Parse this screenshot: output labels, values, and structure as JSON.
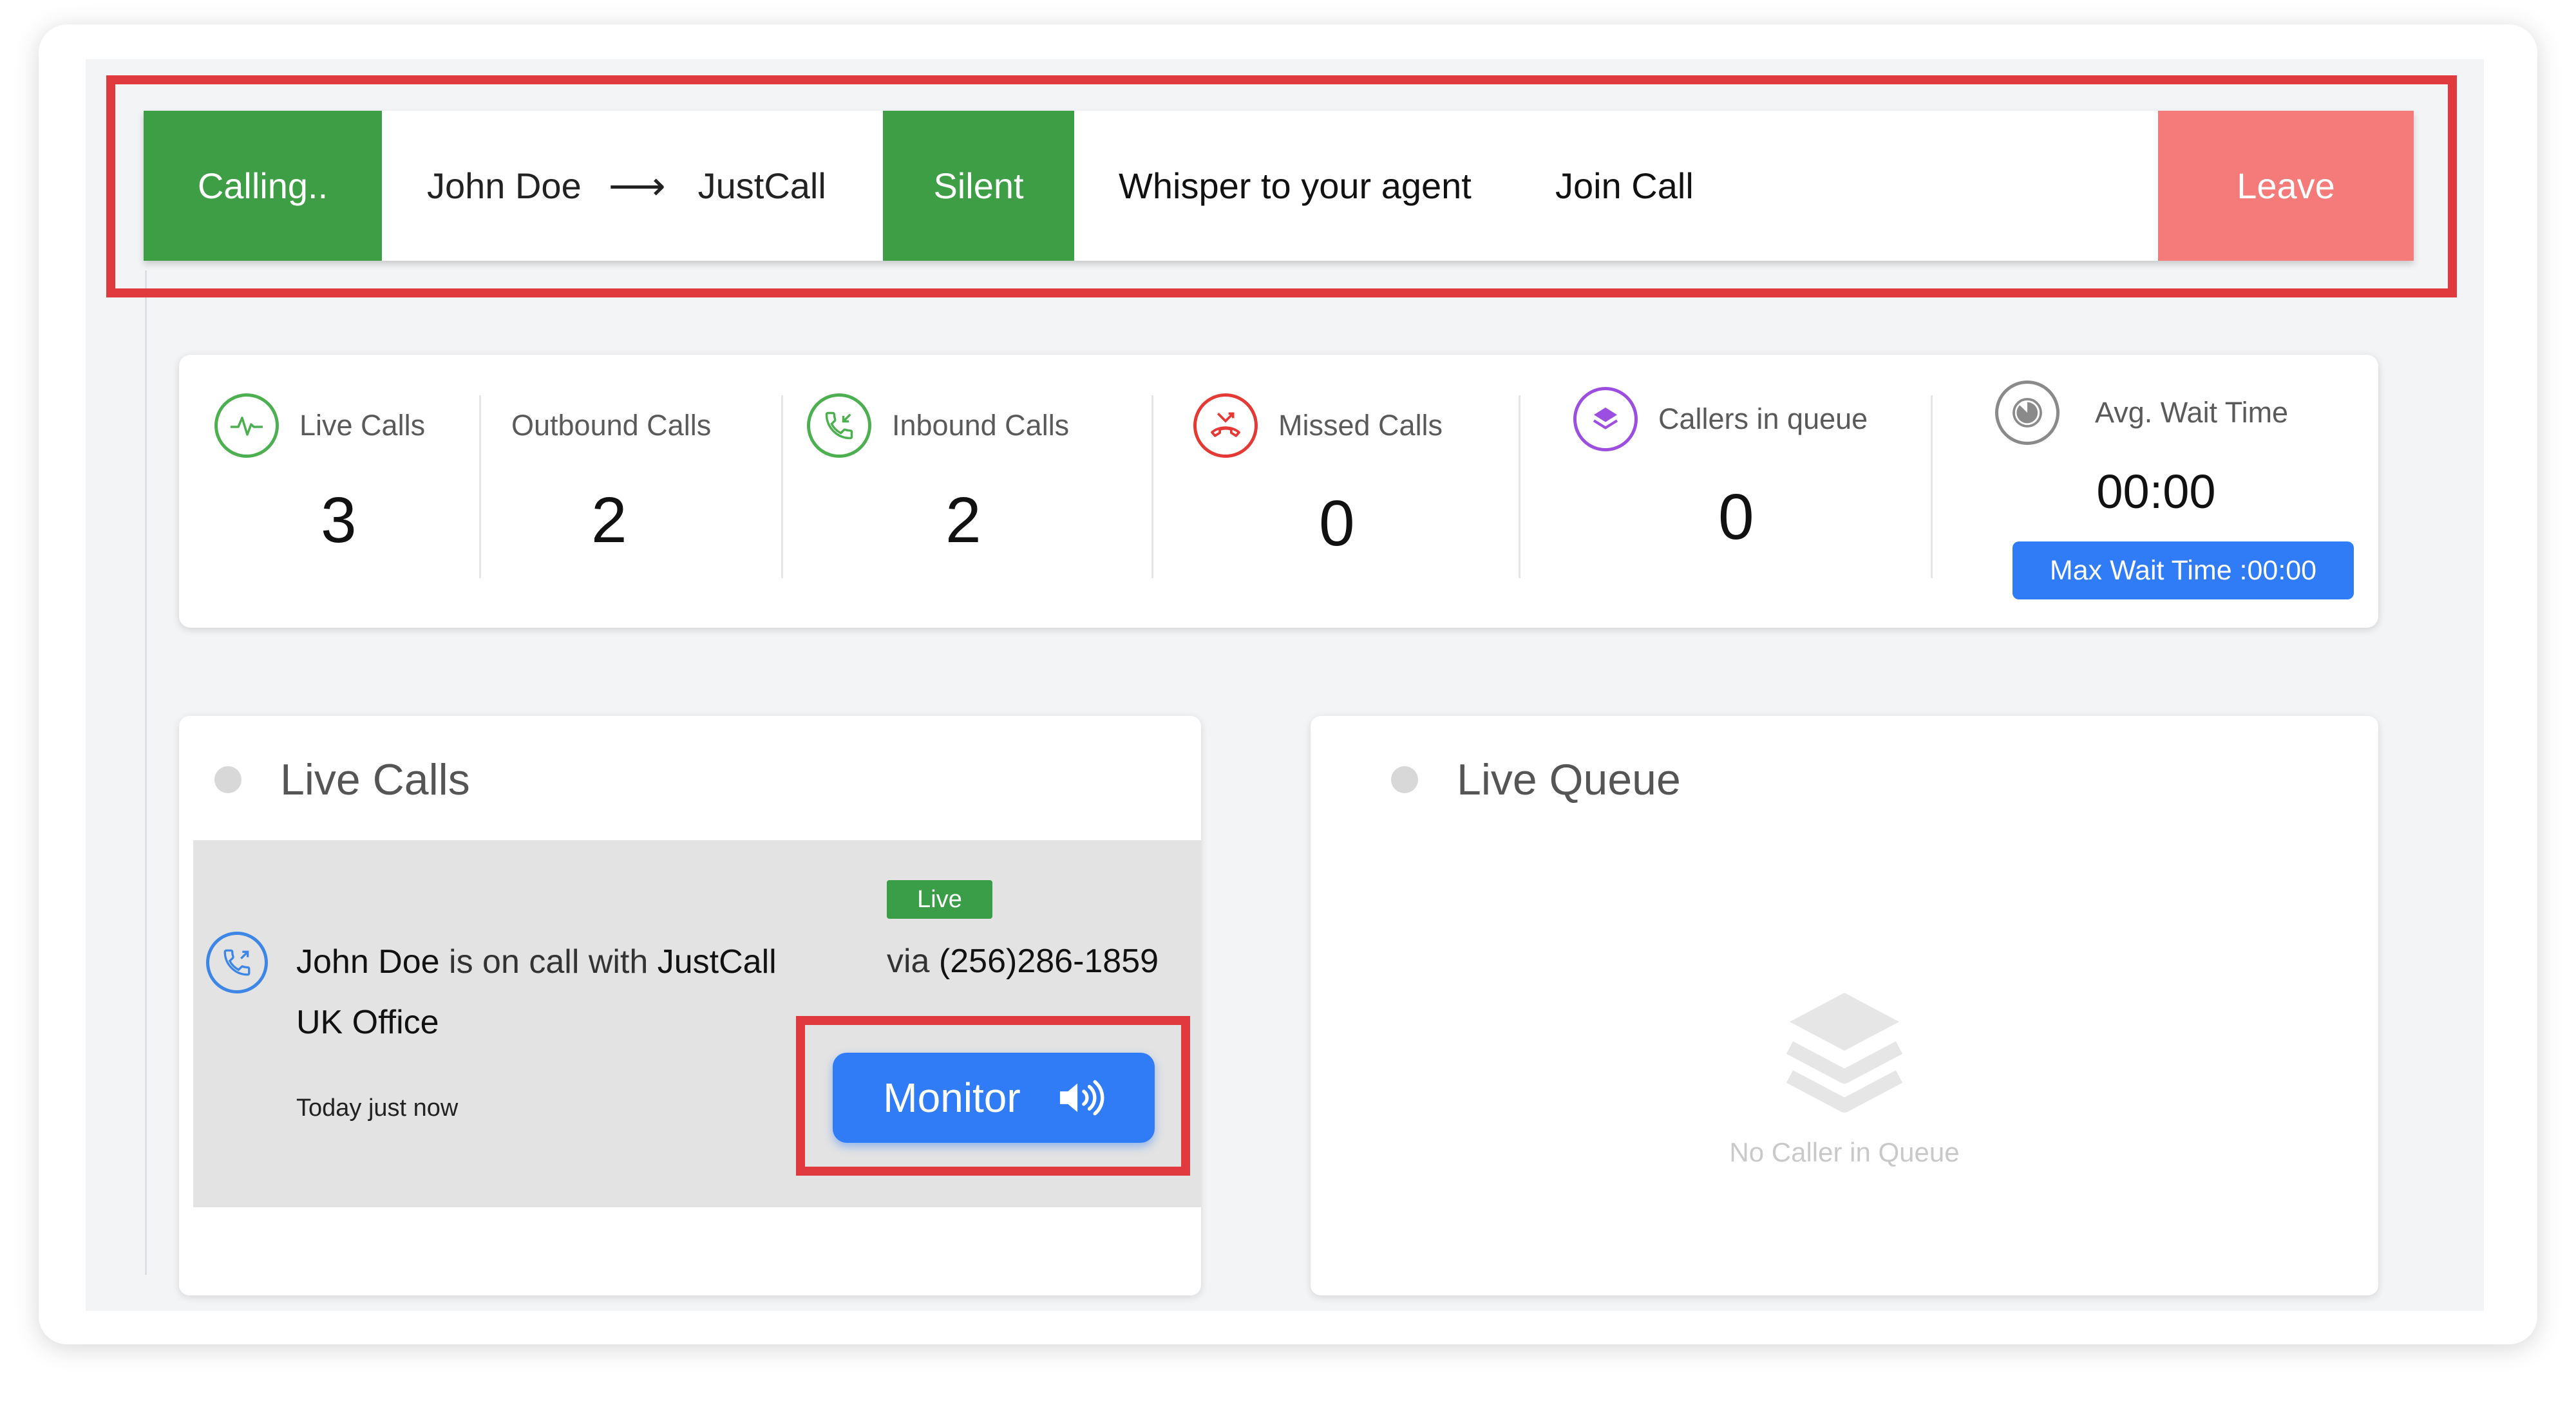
{
  "call_bar": {
    "status": "Calling..",
    "from": "John Doe",
    "to": "JustCall",
    "silent_label": "Silent",
    "whisper_label": "Whisper to your agent",
    "join_label": "Join Call",
    "leave_label": "Leave"
  },
  "stats": {
    "live_calls": {
      "label": "Live Calls",
      "value": "3"
    },
    "outbound_calls": {
      "label": "Outbound Calls",
      "value": "2"
    },
    "inbound_calls": {
      "label": "Inbound Calls",
      "value": "2"
    },
    "missed_calls": {
      "label": "Missed Calls",
      "value": "0"
    },
    "callers_in_queue": {
      "label": "Callers in queue",
      "value": "0"
    },
    "avg_wait_time": {
      "label": "Avg. Wait Time",
      "value": "00:00"
    },
    "max_wait_label": "Max Wait Time :00:00"
  },
  "live_calls_panel": {
    "title": "Live Calls",
    "call": {
      "agent": "John Doe",
      "middle_text": " is on call with ",
      "number_name": "JustCall UK Office",
      "time": "Today just now",
      "badge": "Live",
      "via_prefix": "via ",
      "via_number": "(256)286-1859",
      "monitor_label": "Monitor"
    }
  },
  "live_queue_panel": {
    "title": "Live Queue",
    "empty_text": "No Caller in Queue"
  },
  "colors": {
    "green": "#3e9e45",
    "red_leave": "#f47b7a",
    "blue": "#2f7cf6",
    "highlight": "#e03a3e"
  },
  "icons": {
    "live_calls": "pulse-icon",
    "inbound": "incoming-call-icon",
    "missed": "missed-call-icon",
    "queue": "layers-icon",
    "avg_wait": "timer-icon",
    "call_row": "phone-icon",
    "monitor": "speaker-icon",
    "empty_queue": "stack-icon"
  }
}
